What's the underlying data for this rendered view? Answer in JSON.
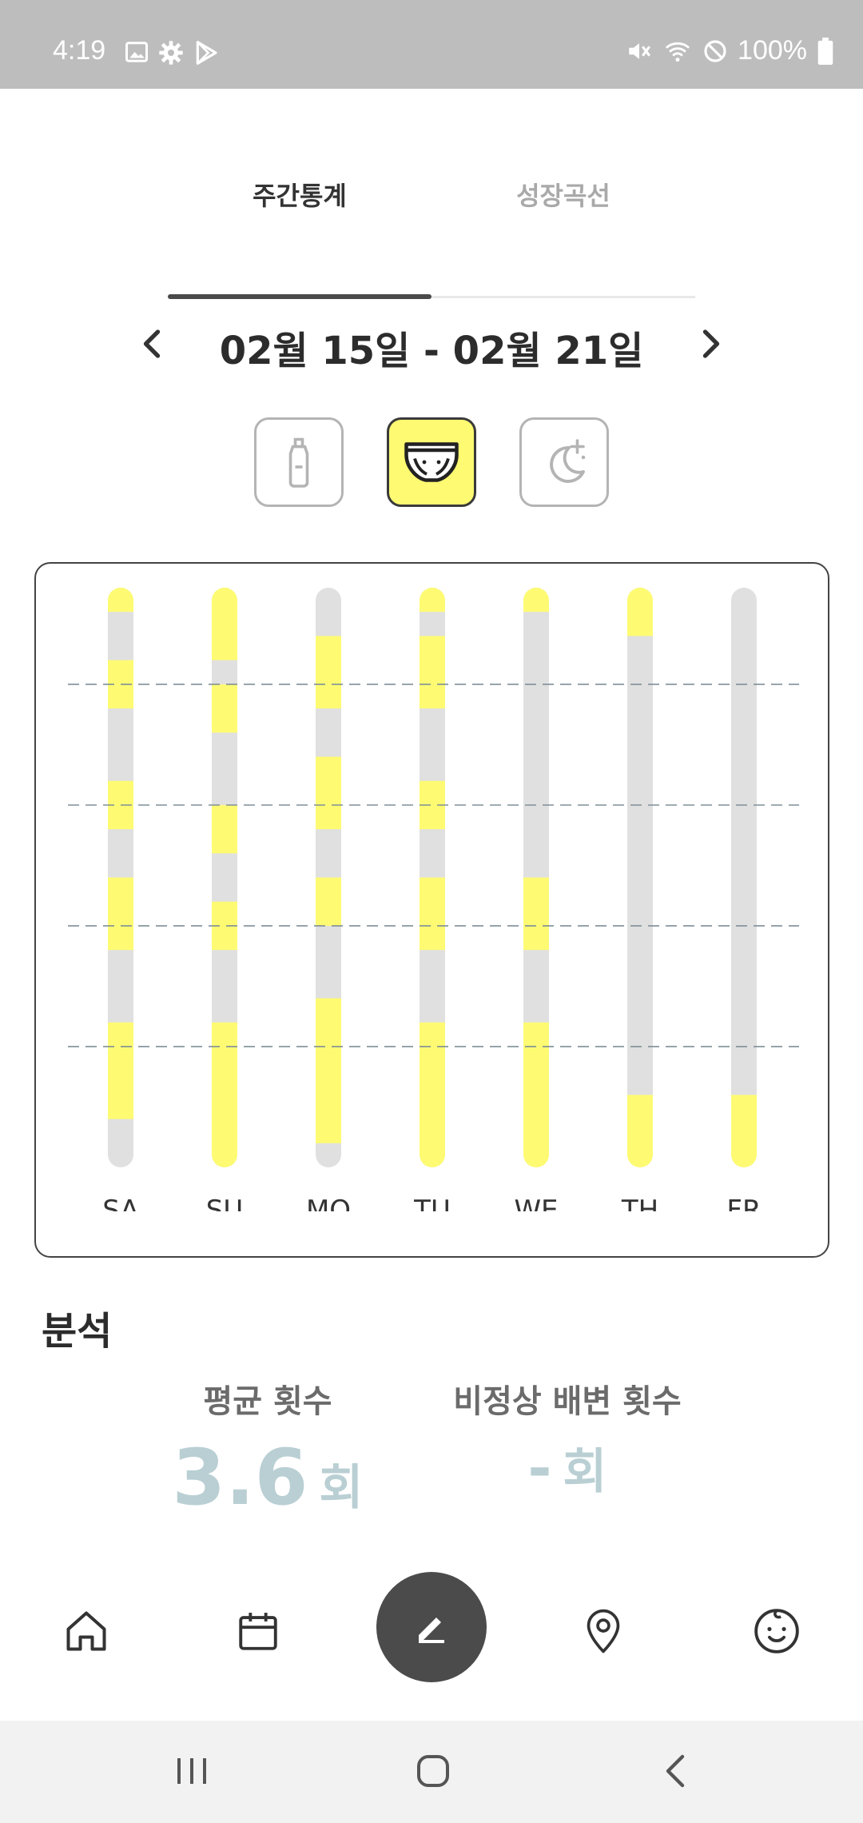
{
  "status_bar": {
    "time": "4:19",
    "left_icons": [
      "image-icon",
      "gear-icon",
      "play-store-icon"
    ],
    "right_icons": [
      "mute-icon",
      "wifi-icon",
      "do-not-disturb-icon"
    ],
    "battery": "100%"
  },
  "tabs": [
    {
      "label": "주간통계",
      "active": true
    },
    {
      "label": "성장곡선",
      "active": false
    }
  ],
  "date_range": {
    "text": "02월 15일  -  02월 21일",
    "prev_icon": "chevron-left-icon",
    "next_icon": "chevron-right-icon"
  },
  "categories": [
    {
      "name": "feeding",
      "icon": "bottle-icon",
      "active": false
    },
    {
      "name": "diaper",
      "icon": "diaper-icon",
      "active": true
    },
    {
      "name": "sleep",
      "icon": "moon-icon",
      "active": false
    }
  ],
  "chart_data": {
    "type": "bar",
    "categories": [
      "SA",
      "SU",
      "MO",
      "TU",
      "WE",
      "TH",
      "FR"
    ],
    "y_range": [
      0,
      24
    ],
    "gridlines": [
      4,
      9,
      14,
      19
    ],
    "colors": {
      "event": "#fefb73",
      "empty": "#e0e0e0"
    },
    "series": [
      {
        "category": "SA",
        "events": [
          [
            0,
            1
          ],
          [
            3,
            5
          ],
          [
            8,
            10
          ],
          [
            12,
            15
          ],
          [
            18,
            22
          ]
        ]
      },
      {
        "category": "SU",
        "events": [
          [
            0,
            3
          ],
          [
            4,
            6
          ],
          [
            9,
            11
          ],
          [
            13,
            15
          ],
          [
            18,
            24
          ]
        ]
      },
      {
        "category": "MO",
        "events": [
          [
            2,
            5
          ],
          [
            7,
            10
          ],
          [
            12,
            14
          ],
          [
            17,
            23
          ]
        ]
      },
      {
        "category": "TU",
        "events": [
          [
            0,
            1
          ],
          [
            2,
            5
          ],
          [
            8,
            10
          ],
          [
            12,
            15
          ],
          [
            18,
            24
          ]
        ]
      },
      {
        "category": "WE",
        "events": [
          [
            0,
            1
          ],
          [
            12,
            15
          ],
          [
            18,
            24
          ]
        ]
      },
      {
        "category": "TH",
        "events": [
          [
            0,
            2
          ],
          [
            21,
            24
          ]
        ]
      },
      {
        "category": "FR",
        "events": [
          [
            21,
            24
          ]
        ]
      }
    ]
  },
  "analysis": {
    "title": "분석",
    "avg_label": "평균 횟수",
    "avg_value": "3.6",
    "avg_unit": "회",
    "abnormal_label": "비정상 배변 횟수",
    "abnormal_value": "-",
    "abnormal_unit": "회"
  },
  "bottom_nav": [
    "home-icon",
    "calendar-icon",
    "edit-icon",
    "location-icon",
    "baby-icon"
  ],
  "system_nav": [
    "recents-icon",
    "home-icon",
    "back-icon"
  ]
}
